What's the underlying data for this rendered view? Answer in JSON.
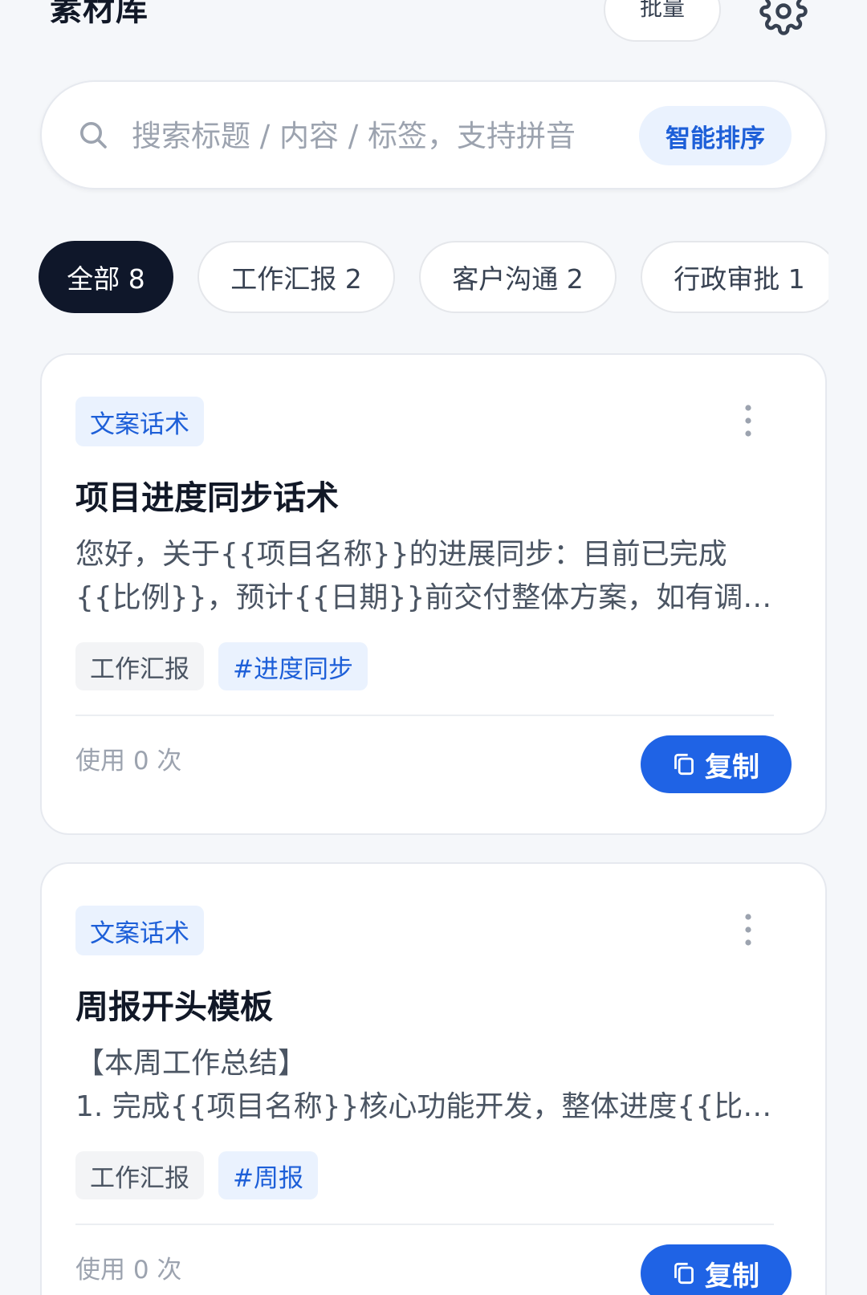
{
  "header": {
    "title": "素材库",
    "batch_label": "批量"
  },
  "search": {
    "placeholder": "搜索标题 / 内容 / 标签，支持拼音",
    "value": "",
    "smart_sort_label": "智能排序"
  },
  "categories": [
    {
      "label": "全部 8",
      "active": true
    },
    {
      "label": "工作汇报 2",
      "active": false
    },
    {
      "label": "客户沟通 2",
      "active": false
    },
    {
      "label": "行政审批 1",
      "active": false
    }
  ],
  "cards": [
    {
      "type": "文案话术",
      "title": "项目进度同步话术",
      "content": "您好，关于{{项目名称}}的进展同步：目前已完成{{比例}}，预计{{日期}}前交付整体方案，如有调整…",
      "tags": [
        {
          "label": "工作汇报",
          "kind": "category"
        },
        {
          "label": "#进度同步",
          "kind": "hashtag"
        }
      ],
      "usage": "使用 0 次",
      "copy_label": "复制"
    },
    {
      "type": "文案话术",
      "title": "周报开头模板",
      "content": "【本周工作总结】\n1. 完成{{项目名称}}核心功能开发，整体进度{{比…",
      "tags": [
        {
          "label": "工作汇报",
          "kind": "category"
        },
        {
          "label": "#周报",
          "kind": "hashtag"
        }
      ],
      "usage": "使用 0 次",
      "copy_label": "复制"
    }
  ],
  "icons": {
    "search": "search-icon",
    "settings": "gear-icon",
    "more": "more-vertical-icon",
    "copy": "copy-icon"
  },
  "colors": {
    "accent": "#1f63e5",
    "accent_soft": "#eaf2fe",
    "active_chip": "#0f172a",
    "background": "#f5f7fa"
  }
}
